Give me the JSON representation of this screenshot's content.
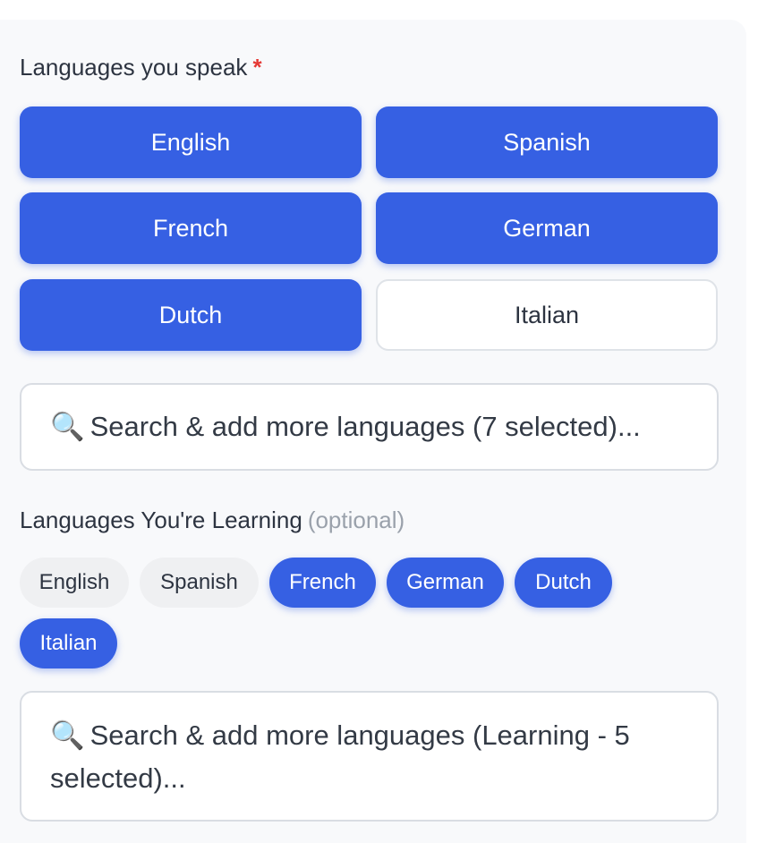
{
  "speak": {
    "label": "Languages you speak",
    "required_marker": "*",
    "options": [
      {
        "label": "English",
        "selected": true
      },
      {
        "label": "Spanish",
        "selected": true
      },
      {
        "label": "French",
        "selected": true
      },
      {
        "label": "German",
        "selected": true
      },
      {
        "label": "Dutch",
        "selected": true
      },
      {
        "label": "Italian",
        "selected": false
      }
    ],
    "search_icon": "🔍",
    "search_text": "Search & add more languages (7 selected)..."
  },
  "learning": {
    "label": "Languages You're Learning",
    "optional_text": "(optional)",
    "options": [
      {
        "label": "English",
        "selected": false
      },
      {
        "label": "Spanish",
        "selected": false
      },
      {
        "label": "French",
        "selected": true
      },
      {
        "label": "German",
        "selected": true
      },
      {
        "label": "Dutch",
        "selected": true
      },
      {
        "label": "Italian",
        "selected": true
      }
    ],
    "search_icon": "🔍",
    "search_text": "Search & add more languages (Learning - 5 selected)..."
  },
  "colors": {
    "accent": "#3660e3",
    "required": "#e53935",
    "muted": "#9aa1ab",
    "panel_bg": "#f8f9fb"
  }
}
